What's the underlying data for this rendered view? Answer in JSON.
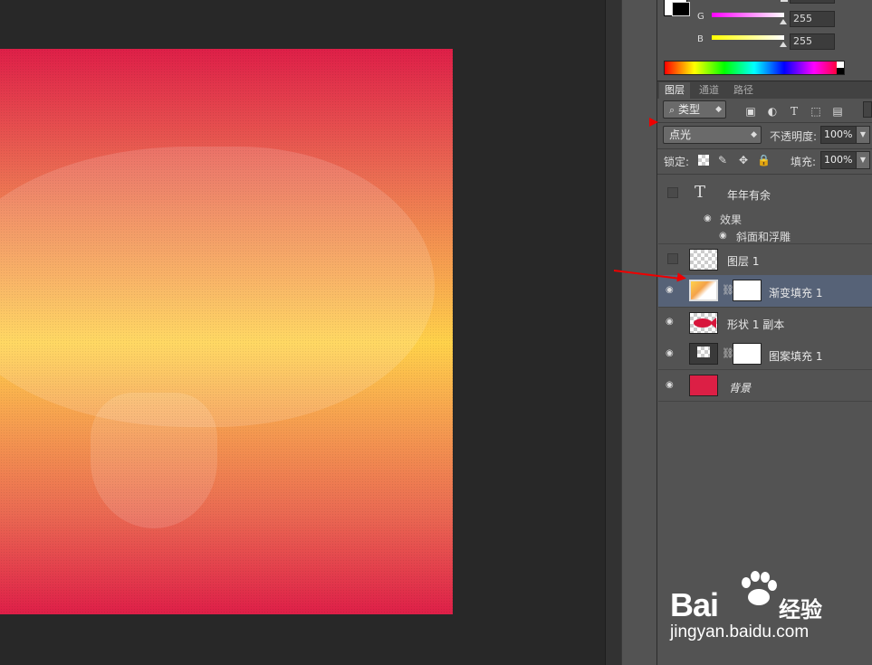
{
  "color_panel": {
    "channels": [
      {
        "label": "G",
        "value": "255",
        "gradient": "linear-gradient(to right,#ff00ff,#ffffff)"
      },
      {
        "label": "B",
        "value": "255",
        "gradient": "linear-gradient(to right,#ffff00,#ffffff)"
      }
    ]
  },
  "tabs": [
    {
      "label": "图层",
      "active": true
    },
    {
      "label": "通道",
      "active": false
    },
    {
      "label": "路径",
      "active": false
    }
  ],
  "filter": {
    "kind_label": "类型",
    "icons": [
      "image-filter-icon",
      "adjustment-filter-icon",
      "type-filter-icon",
      "shape-filter-icon",
      "smart-object-filter-icon"
    ]
  },
  "blend": {
    "mode": "点光",
    "opacity_label": "不透明度:",
    "opacity_value": "100%"
  },
  "lock": {
    "label": "锁定:",
    "fill_label": "填充:",
    "fill_value": "100%"
  },
  "layers": {
    "text_layer": {
      "name": "年年有余",
      "effects_label": "效果",
      "effect_name": "斜面和浮雕"
    },
    "layer1": {
      "name": "图层 1"
    },
    "gradient_fill": {
      "name": "渐变填充 1"
    },
    "shape_copy": {
      "name": "形状 1 副本"
    },
    "pattern_fill": {
      "name": "图案填充 1"
    },
    "background": {
      "name": "背景"
    }
  },
  "colors": {
    "accent_red": "#e00000",
    "selection": "#566277",
    "background_swatch": "#dc1f45"
  },
  "watermark": {
    "brand": "Bai",
    "brand_suffix": "经验",
    "url": "jingyan.baidu.com"
  }
}
